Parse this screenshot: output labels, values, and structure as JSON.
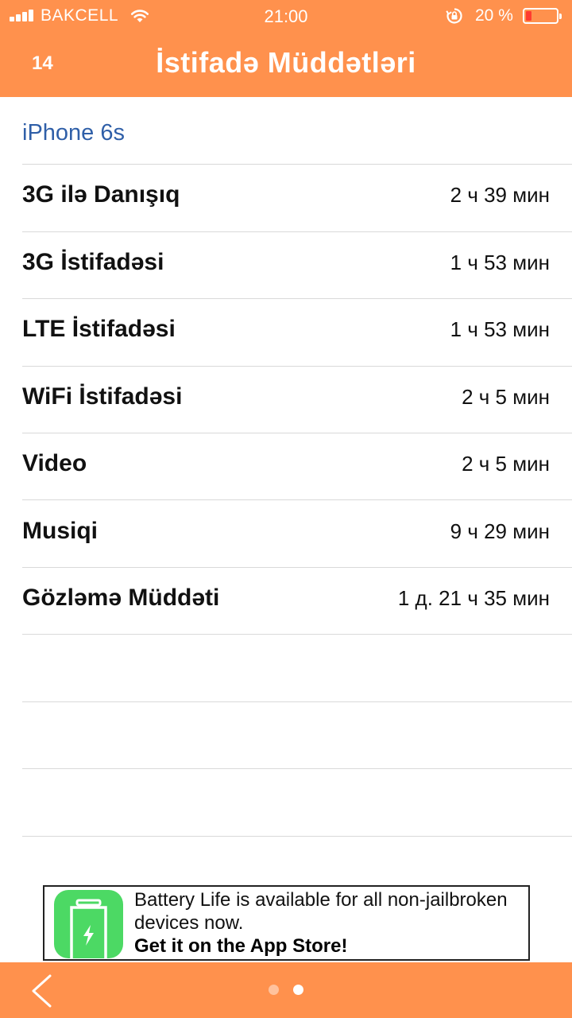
{
  "status_bar": {
    "carrier": "BAKCELL",
    "time": "21:00",
    "battery_percent": "20 %",
    "battery_level": 0.2
  },
  "nav": {
    "count": "14",
    "title": "İstifadə Müddətləri"
  },
  "device": "iPhone 6s",
  "rows": [
    {
      "label": "3G ilə Danışıq",
      "value": "2 ч 39 мин"
    },
    {
      "label": "3G İstifadəsi",
      "value": "1 ч 53 мин"
    },
    {
      "label": "LTE İstifadəsi",
      "value": "1 ч 53 мин"
    },
    {
      "label": "WiFi İstifadəsi",
      "value": "2 ч 5 мин"
    },
    {
      "label": "Video",
      "value": "2 ч 5 мин"
    },
    {
      "label": "Musiqi",
      "value": "9 ч 29 мин"
    },
    {
      "label": "Gözləmə Müddəti",
      "value": "1 д. 21 ч 35 мин"
    }
  ],
  "ad": {
    "line1": "Battery Life is available for all non-jailbroken",
    "line2": "devices now.",
    "line3": "Get it on the App Store!",
    "icon": "battery-charging-icon"
  },
  "pager": {
    "pages": 2,
    "current": 2
  },
  "colors": {
    "header": "#FF914D",
    "section_title": "#2F5FA8",
    "battery_low": "#FF3B30",
    "ad_icon": "#4CD964"
  }
}
